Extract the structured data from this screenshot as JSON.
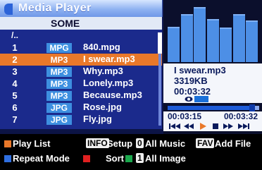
{
  "window": {
    "title": "Media Player"
  },
  "path": {
    "label": "SOME"
  },
  "list": {
    "parent_label": "/..",
    "items": [
      {
        "num": "1",
        "type": "MPG",
        "name": "840.mpg",
        "selected": false
      },
      {
        "num": "2",
        "type": "MP3",
        "name": "I swear.mp3",
        "selected": true
      },
      {
        "num": "3",
        "type": "MP3",
        "name": "Why.mp3",
        "selected": false
      },
      {
        "num": "4",
        "type": "MP3",
        "name": "Lonely.mp3",
        "selected": false
      },
      {
        "num": "5",
        "type": "MP3",
        "name": "Because.mp3",
        "selected": false
      },
      {
        "num": "6",
        "type": "JPG",
        "name": "Rose.jpg",
        "selected": false
      },
      {
        "num": "7",
        "type": "JPG",
        "name": "Fly.jpg",
        "selected": false
      }
    ]
  },
  "now_playing": {
    "file": "I swear.mp3",
    "size": "3319KB",
    "duration": "00:03:32",
    "elapsed": "00:03:15",
    "total": "00:03:32",
    "progress": 0.92
  },
  "spectrum_levels": [
    0.58,
    0.8,
    0.93,
    0.72,
    0.57,
    0.8,
    0.7
  ],
  "controls": [
    "previous-icon",
    "rewind-icon",
    "play-icon",
    "stop-icon",
    "fast-forward-icon",
    "next-icon"
  ],
  "help": {
    "playlist": "Play List",
    "info_key": "INFO",
    "setup": "Setup",
    "key0": "0",
    "all_music": "All Music",
    "fav_key": "FAV",
    "add_file": "Add File",
    "repeat_mode": "Repeat Mode",
    "sort": "Sort",
    "key1": "1",
    "all_image": "All Image"
  },
  "colors": {
    "orange": "#e9782a",
    "blue_sq": "#2f6fe0",
    "red_sq": "#e02020",
    "green_sq": "#1aa84c"
  }
}
